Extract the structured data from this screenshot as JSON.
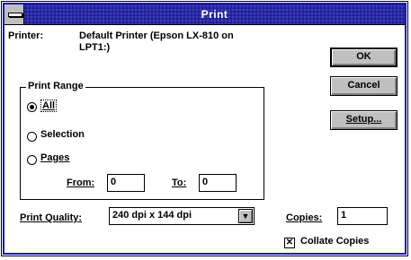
{
  "window": {
    "title": "Print"
  },
  "printer": {
    "label": "Printer:",
    "value_line1": "Default Printer (Epson LX-810 on",
    "value_line2": "LPT1:)"
  },
  "buttons": {
    "ok": "OK",
    "cancel": "Cancel",
    "setup": "Setup..."
  },
  "print_range": {
    "label": "Print Range",
    "options": [
      {
        "label": "All",
        "selected": true
      },
      {
        "label": "Selection",
        "selected": false
      },
      {
        "label": "Pages",
        "selected": false
      }
    ],
    "from_label": "From:",
    "from_value": "0",
    "to_label": "To:",
    "to_value": "0"
  },
  "print_quality": {
    "label": "Print Quality:",
    "value": "240 dpi x 144 dpi"
  },
  "copies": {
    "label": "Copies:",
    "value": "1"
  },
  "collate": {
    "label": "Collate Copies",
    "checked": true
  },
  "colors": {
    "title_bar": "#2a2aa0",
    "frame": "#1a1ab2",
    "button_face": "#c0c0c0"
  }
}
